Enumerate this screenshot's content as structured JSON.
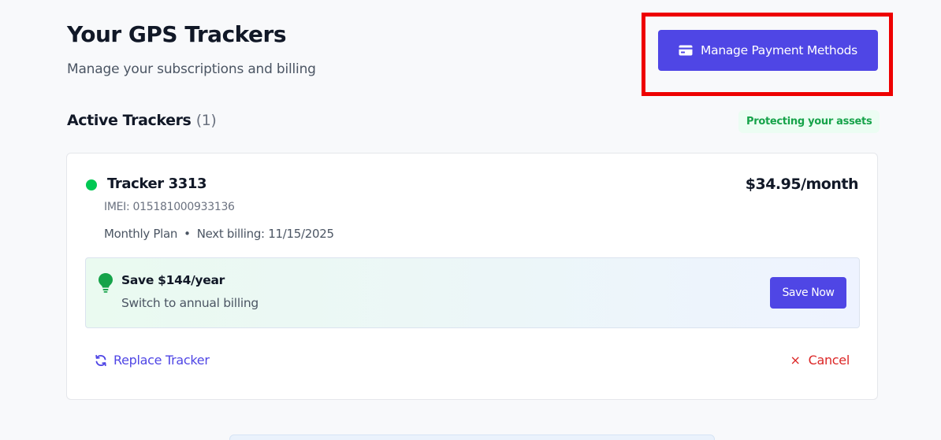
{
  "header": {
    "title": "Your GPS Trackers",
    "subtitle": "Manage your subscriptions and billing",
    "payment_button": {
      "label": "Manage Payment Methods",
      "icon": "credit-card-icon"
    }
  },
  "section": {
    "title": "Active Trackers",
    "count": "(1)",
    "badge": "Protecting your assets"
  },
  "tracker": {
    "name": "Tracker 3313",
    "status": "active",
    "status_color": "#00c853",
    "price": "$34.95/month",
    "imei": "IMEI: 015181000933136",
    "plan": "Monthly Plan",
    "separator": "•",
    "next_billing": "Next billing: 11/15/2025"
  },
  "promo": {
    "icon": "lightbulb-icon",
    "title": "Save $144/year",
    "subtitle": "Switch to annual billing",
    "button_label": "Save Now"
  },
  "actions": {
    "replace": {
      "label": "Replace Tracker",
      "icon": "refresh-icon"
    },
    "cancel": {
      "label": "Cancel",
      "icon": "close-icon",
      "glyph": "×"
    }
  },
  "colors": {
    "accent": "#4f46e5",
    "success": "#16a34a",
    "danger": "#dc2626",
    "highlight": "#ee0000"
  }
}
